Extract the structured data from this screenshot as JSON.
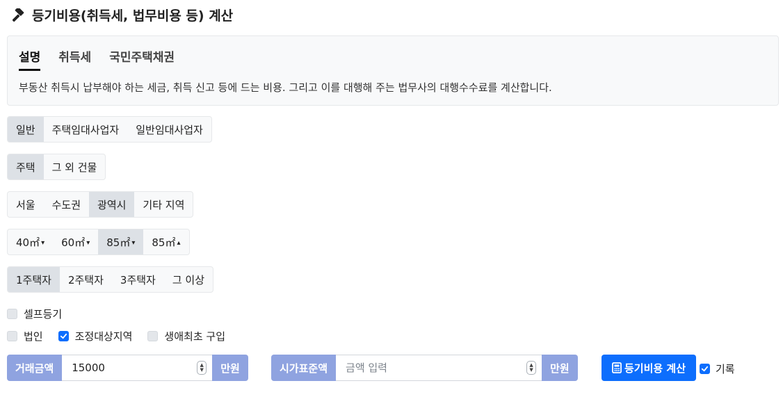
{
  "header": {
    "title": "등기비용(취득세, 법무비용 등) 계산",
    "icon": "hammer-icon"
  },
  "info": {
    "tabs": [
      {
        "label": "설명",
        "active": true
      },
      {
        "label": "취득세",
        "active": false
      },
      {
        "label": "국민주택채권",
        "active": false
      }
    ],
    "description": "부동산 취득시 납부해야 하는 세금, 취득 신고 등에 드는 비용. 그리고 이를 대행해 주는 법무사의 대행수수료를 계산합니다."
  },
  "groups": {
    "owner_type": {
      "options": [
        "일반",
        "주택임대사업자",
        "일반임대사업자"
      ],
      "selected": "일반"
    },
    "building_type": {
      "options": [
        "주택",
        "그 외 건물"
      ],
      "selected": "주택"
    },
    "region": {
      "options": [
        "서울",
        "수도권",
        "광역시",
        "기타 지역"
      ],
      "selected": "광역시"
    },
    "area": {
      "options": [
        {
          "label": "40㎡",
          "caret": "▾"
        },
        {
          "label": "60㎡",
          "caret": "▾"
        },
        {
          "label": "85㎡",
          "caret": "▾"
        },
        {
          "label": "85㎡",
          "caret": "▴"
        }
      ],
      "selected_index": 2
    },
    "house_count": {
      "options": [
        "1주택자",
        "2주택자",
        "3주택자",
        "그 이상"
      ],
      "selected": "1주택자"
    }
  },
  "checkboxes": {
    "self_registration": {
      "label": "셀프등기",
      "checked": false
    },
    "corporation": {
      "label": "법인",
      "checked": false
    },
    "adjusted_area": {
      "label": "조정대상지역",
      "checked": true
    },
    "first_purchase": {
      "label": "생애최초 구입",
      "checked": false
    }
  },
  "inputs": {
    "trade_amount": {
      "label": "거래금액",
      "value": "15000",
      "unit": "만원"
    },
    "standard_price": {
      "label": "시가표준액",
      "value": "",
      "placeholder": "금액 입력",
      "unit": "만원"
    }
  },
  "actions": {
    "calculate_label": "등기비용 계산",
    "calculate_icon": "calculator-icon",
    "record": {
      "label": "기록",
      "checked": true
    }
  },
  "colors": {
    "primary": "#0d6efd",
    "addon": "#8fa3e0",
    "selected_segment": "#dde1e6"
  }
}
